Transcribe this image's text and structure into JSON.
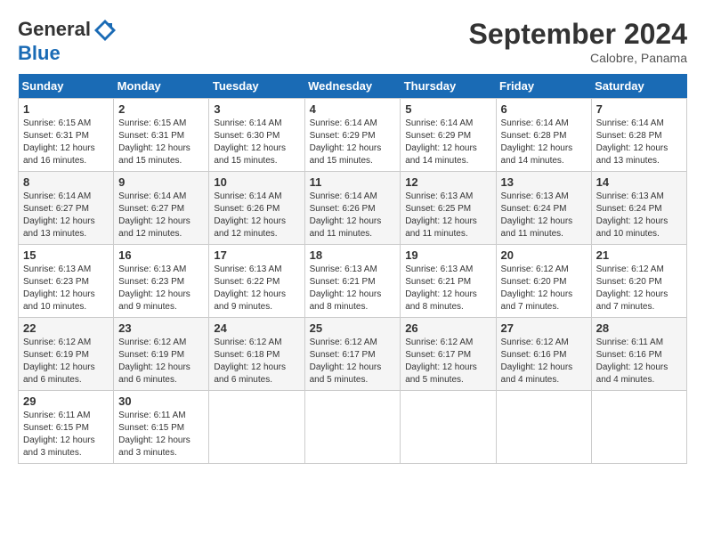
{
  "header": {
    "logo_line1": "General",
    "logo_line2": "Blue",
    "month": "September 2024",
    "location": "Calobre, Panama"
  },
  "days_of_week": [
    "Sunday",
    "Monday",
    "Tuesday",
    "Wednesday",
    "Thursday",
    "Friday",
    "Saturday"
  ],
  "weeks": [
    [
      {
        "day": "1",
        "sunrise": "6:15 AM",
        "sunset": "6:31 PM",
        "daylight": "12 hours and 16 minutes."
      },
      {
        "day": "2",
        "sunrise": "6:15 AM",
        "sunset": "6:31 PM",
        "daylight": "12 hours and 15 minutes."
      },
      {
        "day": "3",
        "sunrise": "6:14 AM",
        "sunset": "6:30 PM",
        "daylight": "12 hours and 15 minutes."
      },
      {
        "day": "4",
        "sunrise": "6:14 AM",
        "sunset": "6:29 PM",
        "daylight": "12 hours and 15 minutes."
      },
      {
        "day": "5",
        "sunrise": "6:14 AM",
        "sunset": "6:29 PM",
        "daylight": "12 hours and 14 minutes."
      },
      {
        "day": "6",
        "sunrise": "6:14 AM",
        "sunset": "6:28 PM",
        "daylight": "12 hours and 14 minutes."
      },
      {
        "day": "7",
        "sunrise": "6:14 AM",
        "sunset": "6:28 PM",
        "daylight": "12 hours and 13 minutes."
      }
    ],
    [
      {
        "day": "8",
        "sunrise": "6:14 AM",
        "sunset": "6:27 PM",
        "daylight": "12 hours and 13 minutes."
      },
      {
        "day": "9",
        "sunrise": "6:14 AM",
        "sunset": "6:27 PM",
        "daylight": "12 hours and 12 minutes."
      },
      {
        "day": "10",
        "sunrise": "6:14 AM",
        "sunset": "6:26 PM",
        "daylight": "12 hours and 12 minutes."
      },
      {
        "day": "11",
        "sunrise": "6:14 AM",
        "sunset": "6:26 PM",
        "daylight": "12 hours and 11 minutes."
      },
      {
        "day": "12",
        "sunrise": "6:13 AM",
        "sunset": "6:25 PM",
        "daylight": "12 hours and 11 minutes."
      },
      {
        "day": "13",
        "sunrise": "6:13 AM",
        "sunset": "6:24 PM",
        "daylight": "12 hours and 11 minutes."
      },
      {
        "day": "14",
        "sunrise": "6:13 AM",
        "sunset": "6:24 PM",
        "daylight": "12 hours and 10 minutes."
      }
    ],
    [
      {
        "day": "15",
        "sunrise": "6:13 AM",
        "sunset": "6:23 PM",
        "daylight": "12 hours and 10 minutes."
      },
      {
        "day": "16",
        "sunrise": "6:13 AM",
        "sunset": "6:23 PM",
        "daylight": "12 hours and 9 minutes."
      },
      {
        "day": "17",
        "sunrise": "6:13 AM",
        "sunset": "6:22 PM",
        "daylight": "12 hours and 9 minutes."
      },
      {
        "day": "18",
        "sunrise": "6:13 AM",
        "sunset": "6:21 PM",
        "daylight": "12 hours and 8 minutes."
      },
      {
        "day": "19",
        "sunrise": "6:13 AM",
        "sunset": "6:21 PM",
        "daylight": "12 hours and 8 minutes."
      },
      {
        "day": "20",
        "sunrise": "6:12 AM",
        "sunset": "6:20 PM",
        "daylight": "12 hours and 7 minutes."
      },
      {
        "day": "21",
        "sunrise": "6:12 AM",
        "sunset": "6:20 PM",
        "daylight": "12 hours and 7 minutes."
      }
    ],
    [
      {
        "day": "22",
        "sunrise": "6:12 AM",
        "sunset": "6:19 PM",
        "daylight": "12 hours and 6 minutes."
      },
      {
        "day": "23",
        "sunrise": "6:12 AM",
        "sunset": "6:19 PM",
        "daylight": "12 hours and 6 minutes."
      },
      {
        "day": "24",
        "sunrise": "6:12 AM",
        "sunset": "6:18 PM",
        "daylight": "12 hours and 6 minutes."
      },
      {
        "day": "25",
        "sunrise": "6:12 AM",
        "sunset": "6:17 PM",
        "daylight": "12 hours and 5 minutes."
      },
      {
        "day": "26",
        "sunrise": "6:12 AM",
        "sunset": "6:17 PM",
        "daylight": "12 hours and 5 minutes."
      },
      {
        "day": "27",
        "sunrise": "6:12 AM",
        "sunset": "6:16 PM",
        "daylight": "12 hours and 4 minutes."
      },
      {
        "day": "28",
        "sunrise": "6:11 AM",
        "sunset": "6:16 PM",
        "daylight": "12 hours and 4 minutes."
      }
    ],
    [
      {
        "day": "29",
        "sunrise": "6:11 AM",
        "sunset": "6:15 PM",
        "daylight": "12 hours and 3 minutes."
      },
      {
        "day": "30",
        "sunrise": "6:11 AM",
        "sunset": "6:15 PM",
        "daylight": "12 hours and 3 minutes."
      },
      null,
      null,
      null,
      null,
      null
    ]
  ],
  "labels": {
    "sunrise": "Sunrise:",
    "sunset": "Sunset:",
    "daylight": "Daylight:"
  }
}
